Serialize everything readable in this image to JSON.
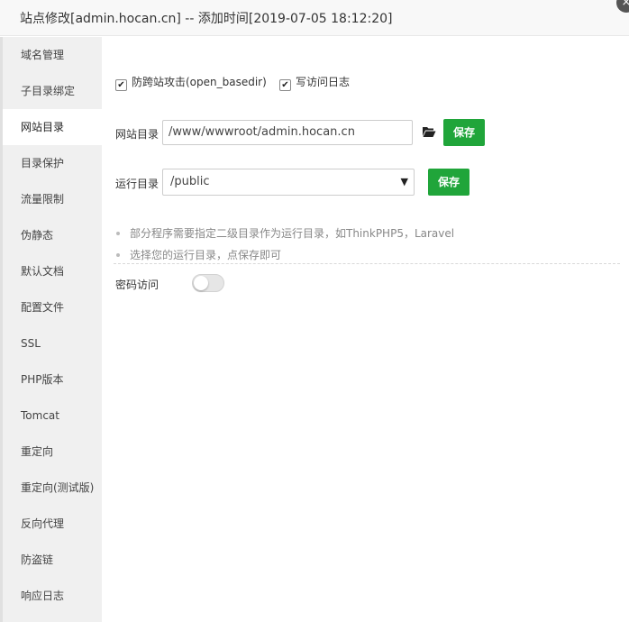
{
  "window": {
    "title": "站点修改[admin.hocan.cn] -- 添加时间[2019-07-05 18:12:20]",
    "close_glyph": "×"
  },
  "sidebar": {
    "items": [
      {
        "label": "域名管理"
      },
      {
        "label": "子目录绑定"
      },
      {
        "label": "网站目录",
        "active": true
      },
      {
        "label": "目录保护"
      },
      {
        "label": "流量限制"
      },
      {
        "label": "伪静态"
      },
      {
        "label": "默认文档"
      },
      {
        "label": "配置文件"
      },
      {
        "label": "SSL"
      },
      {
        "label": "PHP版本"
      },
      {
        "label": "Tomcat"
      },
      {
        "label": "重定向"
      },
      {
        "label": "重定向(测试版)"
      },
      {
        "label": "反向代理"
      },
      {
        "label": "防盗链"
      },
      {
        "label": "响应日志"
      }
    ]
  },
  "main": {
    "anti_cross": {
      "label": "防跨站攻击(open_basedir)",
      "checked": true
    },
    "access_log": {
      "label": "写访问日志",
      "checked": true
    },
    "site_dir": {
      "label": "网站目录",
      "value": "/www/wwwroot/admin.hocan.cn",
      "save_label": "保存"
    },
    "run_dir": {
      "label": "运行目录",
      "selected": "/public",
      "save_label": "保存"
    },
    "tips": [
      "部分程序需要指定二级目录作为运行目录，如ThinkPHP5，Laravel",
      "选择您的运行目录，点保存即可"
    ],
    "password_access": {
      "label": "密码访问",
      "enabled": false
    }
  },
  "icons": {
    "folder": "folder-open-icon",
    "check": "✔",
    "arrow": "▼"
  },
  "colors": {
    "accent": "#20a53a",
    "sidebar_bg": "#f0f0f0"
  }
}
